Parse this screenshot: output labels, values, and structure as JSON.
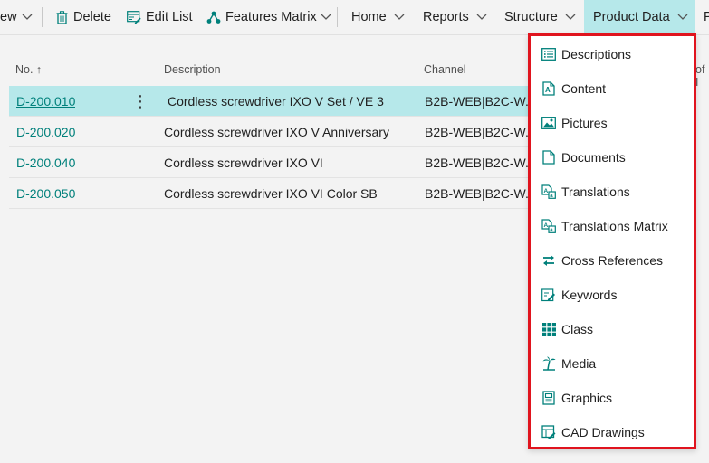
{
  "toolbar": {
    "partial_left": "ew",
    "delete_label": "Delete",
    "edit_list_label": "Edit List",
    "features_matrix_label": "Features Matrix",
    "home_label": "Home",
    "reports_label": "Reports",
    "structure_label": "Structure",
    "product_data_label": "Product Data",
    "partial_right": "P"
  },
  "columns": {
    "no": "No. ↑",
    "description": "Description",
    "channel": "Channel",
    "partial_right": "of I"
  },
  "rows": [
    {
      "no": "D-200.010",
      "description": "Cordless screwdriver IXO V Set / VE 3",
      "channel": "B2B-WEB|B2C-W...",
      "selected": true
    },
    {
      "no": "D-200.020",
      "description": "Cordless screwdriver IXO V Anniversary",
      "channel": "B2B-WEB|B2C-W...",
      "selected": false
    },
    {
      "no": "D-200.040",
      "description": "Cordless screwdriver IXO VI",
      "channel": "B2B-WEB|B2C-W...",
      "selected": false
    },
    {
      "no": "D-200.050",
      "description": "Cordless screwdriver IXO VI Color SB",
      "channel": "B2B-WEB|B2C-W...",
      "selected": false
    }
  ],
  "product_data_menu": [
    {
      "label": "Descriptions",
      "icon": "descriptions-icon"
    },
    {
      "label": "Content",
      "icon": "content-icon"
    },
    {
      "label": "Pictures",
      "icon": "pictures-icon"
    },
    {
      "label": "Documents",
      "icon": "documents-icon"
    },
    {
      "label": "Translations",
      "icon": "translations-icon"
    },
    {
      "label": "Translations Matrix",
      "icon": "translations-matrix-icon"
    },
    {
      "label": "Cross References",
      "icon": "cross-references-icon"
    },
    {
      "label": "Keywords",
      "icon": "keywords-icon"
    },
    {
      "label": "Class",
      "icon": "class-icon"
    },
    {
      "label": "Media",
      "icon": "media-icon"
    },
    {
      "label": "Graphics",
      "icon": "graphics-icon"
    },
    {
      "label": "CAD Drawings",
      "icon": "cad-drawings-icon"
    }
  ],
  "colors": {
    "accent": "#00807b",
    "selected_bg": "#b6e8ea",
    "highlight_border": "#e0141e"
  }
}
